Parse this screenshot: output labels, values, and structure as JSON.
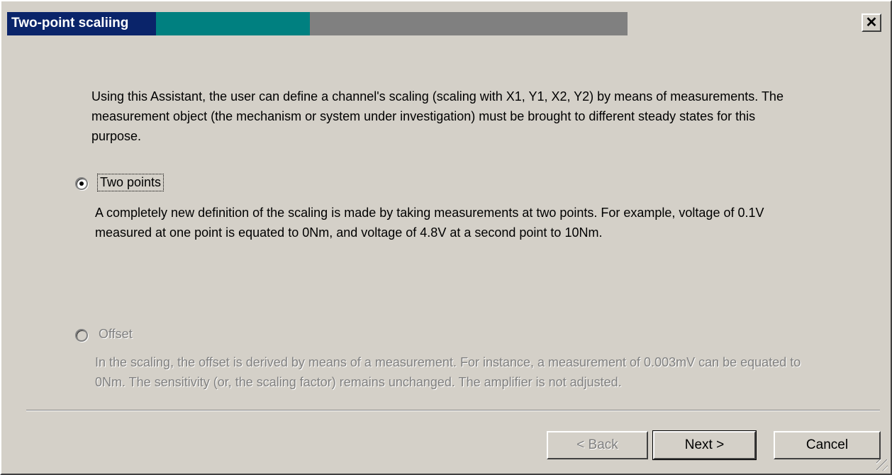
{
  "window": {
    "title": "Two-point scaliing",
    "close_label": "x"
  },
  "intro": {
    "text": "Using this Assistant, the user can define a channel's scaling (scaling with X1, Y1, X2, Y2) by means of measurements. The measurement object (the mechanism or system under investigation) must be brought to different steady states for this purpose."
  },
  "options": [
    {
      "label": "Two points",
      "selected": true,
      "enabled": true,
      "description": "A completely new definition of the scaling is made by taking measurements at two points. For example, voltage of 0.1V measured at one point is equated to 0Nm, and voltage of 4.8V at a second point to 10Nm."
    },
    {
      "label": "Offset",
      "selected": false,
      "enabled": false,
      "description": "In the scaling, the offset is derived by means of a measurement. For instance, a measurement of 0.003mV can be equated to 0Nm. The sensitivity (or, the scaling factor) remains unchanged. The amplifier is not adjusted."
    }
  ],
  "buttons": {
    "back": "< Back",
    "next": "Next >",
    "cancel": "Cancel"
  },
  "colors": {
    "title_active": "#0a246a",
    "title_teal": "#008080",
    "title_gray": "#808080",
    "face": "#d4d0c8"
  }
}
